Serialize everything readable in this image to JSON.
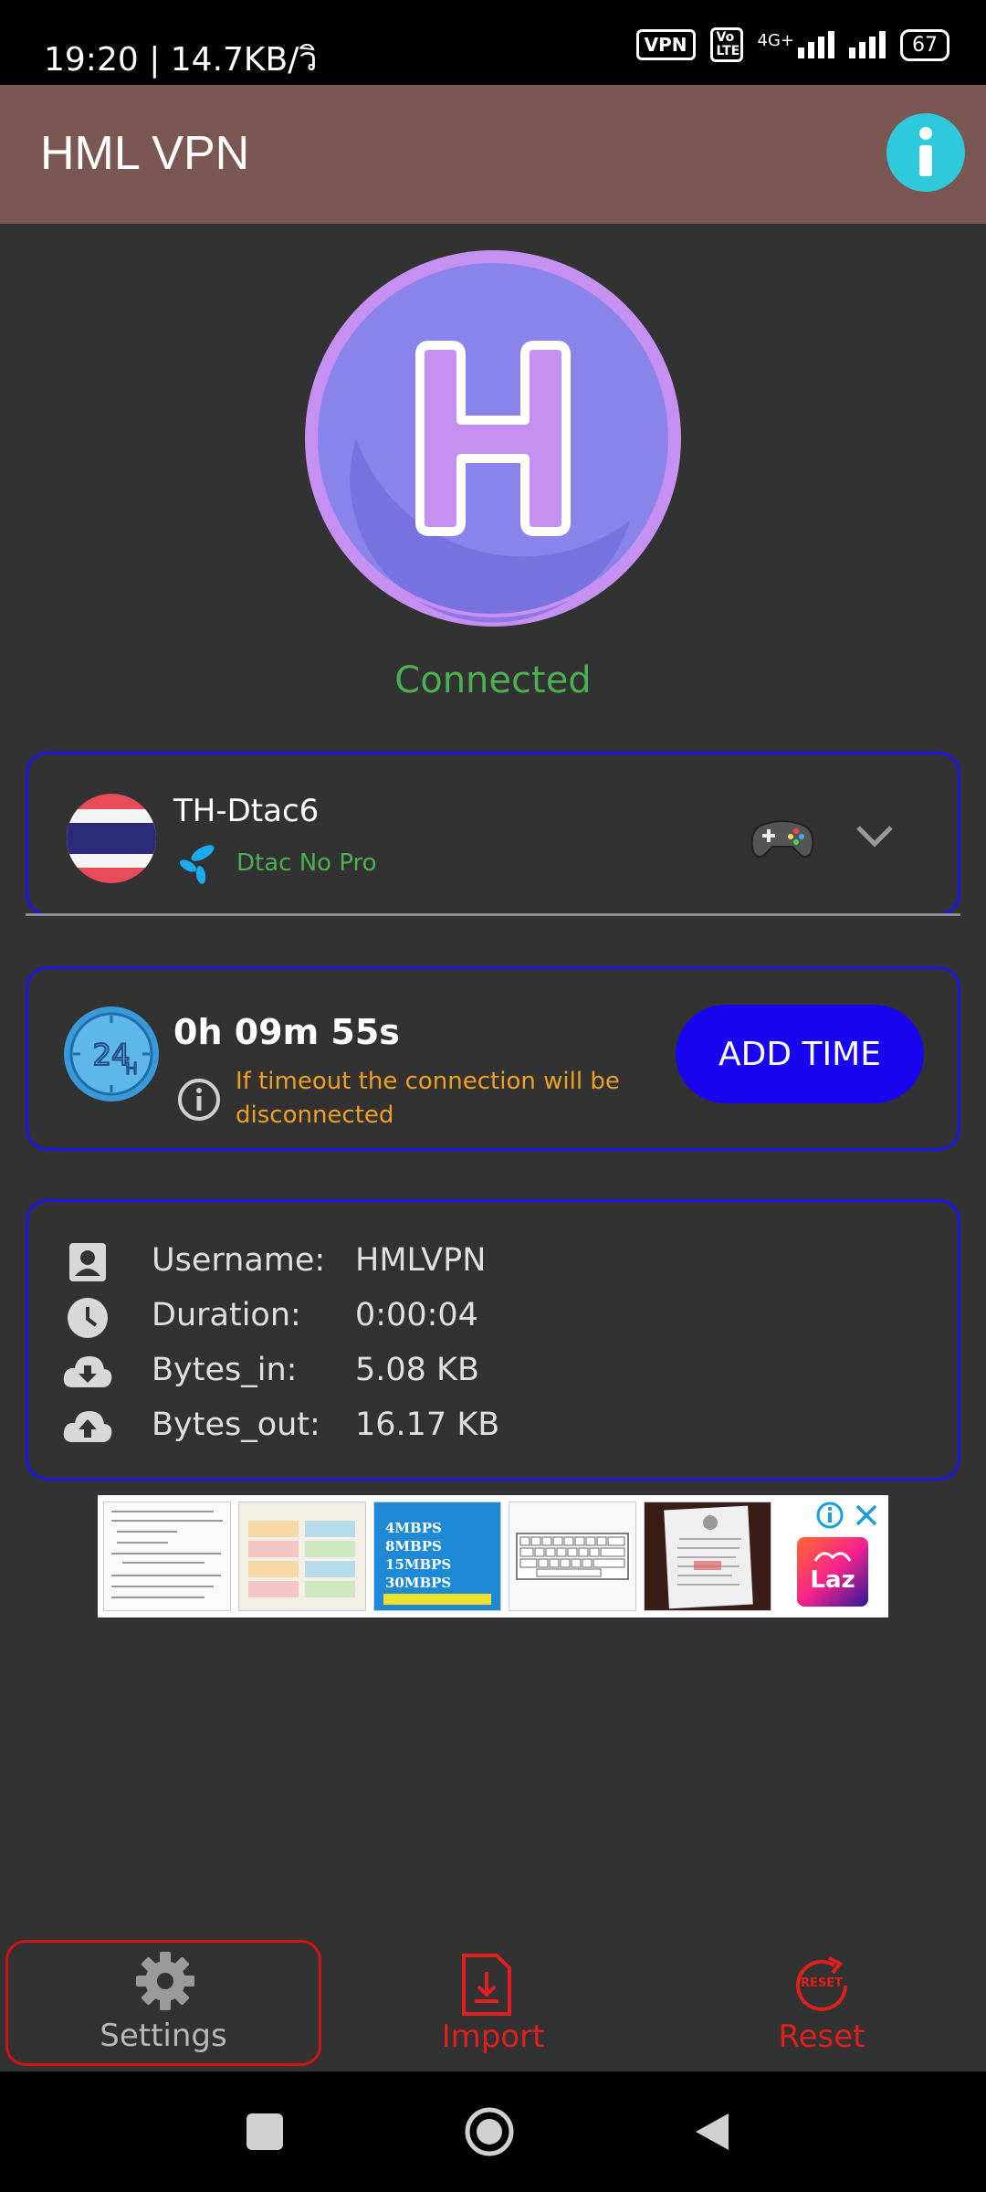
{
  "status_bar": {
    "time": "19:20 | 14.7KB/วิ",
    "vpn_badge": "VPN",
    "volte_badge": "Vo LTE",
    "network": "4G+",
    "battery": "67"
  },
  "app_bar": {
    "title": "HML VPN",
    "info_icon": "info-icon"
  },
  "logo": {
    "letter": "H"
  },
  "connection": {
    "status": "Connected",
    "status_color": "#4caf50"
  },
  "server": {
    "name": "TH-Dtac6",
    "subtitle": "Dtac No Pro",
    "flag_icon": "thailand-flag-icon",
    "carrier_icon": "dtac-logo-icon",
    "game_icon": "gamepad-icon"
  },
  "timer": {
    "remaining": "0h 09m 55s",
    "warning": "If timeout the connection will be disconnected",
    "add_time_label": "ADD TIME"
  },
  "session": {
    "rows": [
      {
        "icon": "user-icon",
        "label": "Username:",
        "value": "HMLVPN"
      },
      {
        "icon": "clock-icon",
        "label": "Duration:",
        "value": "0:00:04"
      },
      {
        "icon": "cloud-download-icon",
        "label": "Bytes_in:",
        "value": "5.08 KB"
      },
      {
        "icon": "cloud-upload-icon",
        "label": "Bytes_out:",
        "value": "16.17 KB"
      }
    ]
  },
  "ad": {
    "laz_label": "Laz",
    "price_lines": [
      "4MBPS",
      "8MBPS",
      "15MBPS",
      "30MBPS"
    ]
  },
  "bottom_nav": {
    "settings": "Settings",
    "import": "Import",
    "reset": "Reset",
    "reset_badge": "RESET"
  },
  "colors": {
    "app_bar": "#7b5753",
    "background": "#323232",
    "card_border": "#1c16e6",
    "add_time_button": "#1a06ee",
    "warning": "#f0a020",
    "nav_red": "#d01414",
    "logo_fill": "#7b73e0",
    "logo_ring": "#c690f2"
  }
}
